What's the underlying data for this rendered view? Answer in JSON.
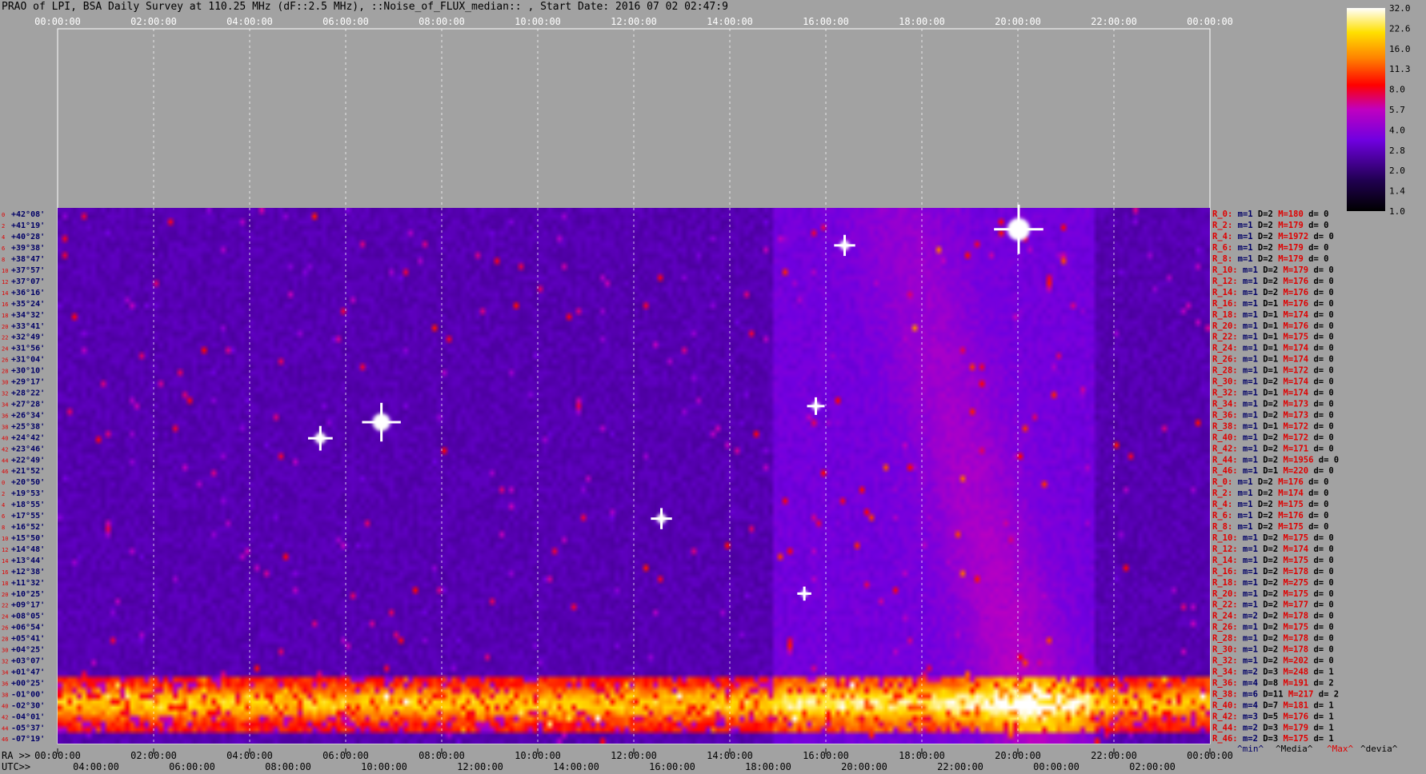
{
  "title": "PRAO of LPI, BSA Daily Survey at 110.25 MHz (dF::2.5 MHz), ::Noise_of_FLUX_median:: , Start Date: 2016 07 02 02:47:9",
  "bottom_labels": {
    "ra_prefix": "RA >>",
    "utc_prefix": "UTC>>",
    "legend_min": "^min^",
    "legend_media": "^Media^",
    "legend_max": "^Max^",
    "legend_devia": "^devia^"
  },
  "colors": {
    "background": "#a2a2a2",
    "row_label_red": "#e00000",
    "row_label_navy": "#000066"
  },
  "chart_data": {
    "type": "heatmap",
    "title": "PRAO of LPI, BSA Daily Survey at 110.25 MHz (dF::2.5 MHz), ::Noise_of_FLUX_median:: , Start Date: 2016 07 02 02:47:9",
    "x_top_ticks": [
      "00:00:00",
      "02:00:00",
      "04:00:00",
      "06:00:00",
      "08:00:00",
      "10:00:00",
      "12:00:00",
      "14:00:00",
      "16:00:00",
      "18:00:00",
      "20:00:00",
      "22:00:00",
      "00:00:00"
    ],
    "x_ra_ticks": [
      "00:00:00",
      "02:00:00",
      "04:00:00",
      "06:00:00",
      "08:00:00",
      "10:00:00",
      "12:00:00",
      "14:00:00",
      "16:00:00",
      "18:00:00",
      "20:00:00",
      "22:00:00",
      "00:00:00"
    ],
    "x_utc_ticks": [
      "04:00:00",
      "06:00:00",
      "08:00:00",
      "10:00:00",
      "12:00:00",
      "14:00:00",
      "16:00:00",
      "18:00:00",
      "20:00:00",
      "22:00:00",
      "00:00:00",
      "02:00:00"
    ],
    "colorbar_ticks": [
      "32.0",
      "22.6",
      "16.0",
      "11.3",
      "8.0",
      "5.7",
      "4.0",
      "2.8",
      "2.0",
      "1.4",
      "1.0"
    ],
    "colormap": "gnuplot-style black-purple-red-yellow-white",
    "declinations": [
      "+42°08'",
      "+41°19'",
      "+40°28'",
      "+39°38'",
      "+38°47'",
      "+37°57'",
      "+37°07'",
      "+36°16'",
      "+35°24'",
      "+34°32'",
      "+33°41'",
      "+32°49'",
      "+31°56'",
      "+31°04'",
      "+30°10'",
      "+29°17'",
      "+28°22'",
      "+27°28'",
      "+26°34'",
      "+25°38'",
      "+24°42'",
      "+23°46'",
      "+22°49'",
      "+21°52'",
      "+20°50'",
      "+19°53'",
      "+18°55'",
      "+17°55'",
      "+16°52'",
      "+15°50'",
      "+14°48'",
      "+13°44'",
      "+12°38'",
      "+11°32'",
      "+10°25'",
      "+09°17'",
      "+08°05'",
      "+06°54'",
      "+05°41'",
      "+04°25'",
      "+03°07'",
      "+01°47'",
      "+00°25'",
      "-01°00'",
      "-02°30'",
      "-04°01'",
      "-05°37'",
      "-07°19'"
    ],
    "beam_stats": [
      {
        "beam": "R_0:",
        "m": "m=1",
        "D": "D=2",
        "M": "M=180",
        "d": "d= 0"
      },
      {
        "beam": "R_2:",
        "m": "m=1",
        "D": "D=2",
        "M": "M=179",
        "d": "d= 0"
      },
      {
        "beam": "R_4:",
        "m": "m=1",
        "D": "D=2",
        "M": "M=1972",
        "d": "d= 0"
      },
      {
        "beam": "R_6:",
        "m": "m=1",
        "D": "D=2",
        "M": "M=179",
        "d": "d= 0"
      },
      {
        "beam": "R_8:",
        "m": "m=1",
        "D": "D=2",
        "M": "M=179",
        "d": "d= 0"
      },
      {
        "beam": "R_10:",
        "m": "m=1",
        "D": "D=2",
        "M": "M=179",
        "d": "d= 0"
      },
      {
        "beam": "R_12:",
        "m": "m=1",
        "D": "D=2",
        "M": "M=176",
        "d": "d= 0"
      },
      {
        "beam": "R_14:",
        "m": "m=1",
        "D": "D=2",
        "M": "M=176",
        "d": "d= 0"
      },
      {
        "beam": "R_16:",
        "m": "m=1",
        "D": "D=1",
        "M": "M=176",
        "d": "d= 0"
      },
      {
        "beam": "R_18:",
        "m": "m=1",
        "D": "D=1",
        "M": "M=174",
        "d": "d= 0"
      },
      {
        "beam": "R_20:",
        "m": "m=1",
        "D": "D=1",
        "M": "M=176",
        "d": "d= 0"
      },
      {
        "beam": "R_22:",
        "m": "m=1",
        "D": "D=1",
        "M": "M=175",
        "d": "d= 0"
      },
      {
        "beam": "R_24:",
        "m": "m=1",
        "D": "D=1",
        "M": "M=174",
        "d": "d= 0"
      },
      {
        "beam": "R_26:",
        "m": "m=1",
        "D": "D=1",
        "M": "M=174",
        "d": "d= 0"
      },
      {
        "beam": "R_28:",
        "m": "m=1",
        "D": "D=1",
        "M": "M=172",
        "d": "d= 0"
      },
      {
        "beam": "R_30:",
        "m": "m=1",
        "D": "D=2",
        "M": "M=174",
        "d": "d= 0"
      },
      {
        "beam": "R_32:",
        "m": "m=1",
        "D": "D=1",
        "M": "M=174",
        "d": "d= 0"
      },
      {
        "beam": "R_34:",
        "m": "m=1",
        "D": "D=2",
        "M": "M=173",
        "d": "d= 0"
      },
      {
        "beam": "R_36:",
        "m": "m=1",
        "D": "D=2",
        "M": "M=173",
        "d": "d= 0"
      },
      {
        "beam": "R_38:",
        "m": "m=1",
        "D": "D=1",
        "M": "M=172",
        "d": "d= 0"
      },
      {
        "beam": "R_40:",
        "m": "m=1",
        "D": "D=2",
        "M": "M=172",
        "d": "d= 0"
      },
      {
        "beam": "R_42:",
        "m": "m=1",
        "D": "D=2",
        "M": "M=171",
        "d": "d= 0"
      },
      {
        "beam": "R_44:",
        "m": "m=1",
        "D": "D=2",
        "M": "M=1956",
        "d": "d= 0"
      },
      {
        "beam": "R_46:",
        "m": "m=1",
        "D": "D=1",
        "M": "M=220",
        "d": "d= 0"
      },
      {
        "beam": "R_0:",
        "m": "m=1",
        "D": "D=2",
        "M": "M=176",
        "d": "d= 0"
      },
      {
        "beam": "R_2:",
        "m": "m=1",
        "D": "D=2",
        "M": "M=174",
        "d": "d= 0"
      },
      {
        "beam": "R_4:",
        "m": "m=1",
        "D": "D=2",
        "M": "M=175",
        "d": "d= 0"
      },
      {
        "beam": "R_6:",
        "m": "m=1",
        "D": "D=2",
        "M": "M=176",
        "d": "d= 0"
      },
      {
        "beam": "R_8:",
        "m": "m=1",
        "D": "D=2",
        "M": "M=175",
        "d": "d= 0"
      },
      {
        "beam": "R_10:",
        "m": "m=1",
        "D": "D=2",
        "M": "M=175",
        "d": "d= 0"
      },
      {
        "beam": "R_12:",
        "m": "m=1",
        "D": "D=2",
        "M": "M=174",
        "d": "d= 0"
      },
      {
        "beam": "R_14:",
        "m": "m=1",
        "D": "D=2",
        "M": "M=175",
        "d": "d= 0"
      },
      {
        "beam": "R_16:",
        "m": "m=1",
        "D": "D=2",
        "M": "M=178",
        "d": "d= 0"
      },
      {
        "beam": "R_18:",
        "m": "m=1",
        "D": "D=2",
        "M": "M=275",
        "d": "d= 0"
      },
      {
        "beam": "R_20:",
        "m": "m=1",
        "D": "D=2",
        "M": "M=175",
        "d": "d= 0"
      },
      {
        "beam": "R_22:",
        "m": "m=1",
        "D": "D=2",
        "M": "M=177",
        "d": "d= 0"
      },
      {
        "beam": "R_24:",
        "m": "m=2",
        "D": "D=2",
        "M": "M=178",
        "d": "d= 0"
      },
      {
        "beam": "R_26:",
        "m": "m=1",
        "D": "D=2",
        "M": "M=175",
        "d": "d= 0"
      },
      {
        "beam": "R_28:",
        "m": "m=1",
        "D": "D=2",
        "M": "M=178",
        "d": "d= 0"
      },
      {
        "beam": "R_30:",
        "m": "m=1",
        "D": "D=2",
        "M": "M=178",
        "d": "d= 0"
      },
      {
        "beam": "R_32:",
        "m": "m=1",
        "D": "D=2",
        "M": "M=202",
        "d": "d= 0"
      },
      {
        "beam": "R_34:",
        "m": "m=2",
        "D": "D=3",
        "M": "M=248",
        "d": "d= 1"
      },
      {
        "beam": "R_36:",
        "m": "m=4",
        "D": "D=8",
        "M": "M=191",
        "d": "d= 2"
      },
      {
        "beam": "R_38:",
        "m": "m=6",
        "D": "D=11",
        "M": "M=217",
        "d": "d= 2"
      },
      {
        "beam": "R_40:",
        "m": "m=4",
        "D": "D=7",
        "M": "M=181",
        "d": "d= 1"
      },
      {
        "beam": "R_42:",
        "m": "m=3",
        "D": "D=5",
        "M": "M=176",
        "d": "d= 1"
      },
      {
        "beam": "R_44:",
        "m": "m=2",
        "D": "D=3",
        "M": "M=179",
        "d": "d= 1"
      },
      {
        "beam": "R_46:",
        "m": "m=2",
        "D": "D=3",
        "M": "M=175",
        "d": "d= 1"
      }
    ]
  }
}
